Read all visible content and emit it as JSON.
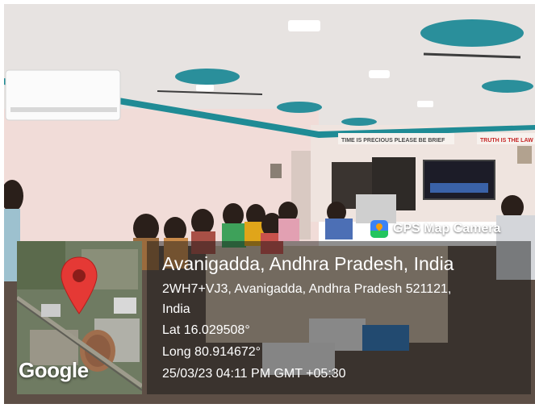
{
  "camera_badge": {
    "app_name": "GPS Map Camera",
    "logo_icon": "gps-map-camera-icon"
  },
  "location": {
    "place": "Avanigadda, Andhra Pradesh, India",
    "address_line1": "2WH7+VJ3, Avanigadda, Andhra Pradesh 521121,",
    "address_line2": "India",
    "latitude": "Lat 16.029508°",
    "longitude": "Long 80.914672°",
    "timestamp": "25/03/23 04:11 PM GMT +05:30"
  },
  "map": {
    "provider": "Google",
    "pin_icon": "map-pin-icon",
    "pin_color": "#e53935"
  },
  "wall_signs": {
    "left": "TIME IS PRECIOUS PLEASE BE BRIEF",
    "right": "TRUTH IS THE LAW"
  },
  "colors": {
    "ceiling_ribbon": "#1f8b95",
    "wall_pink": "#f1dcd8",
    "overlay": "rgba(20,20,20,0.48)"
  }
}
